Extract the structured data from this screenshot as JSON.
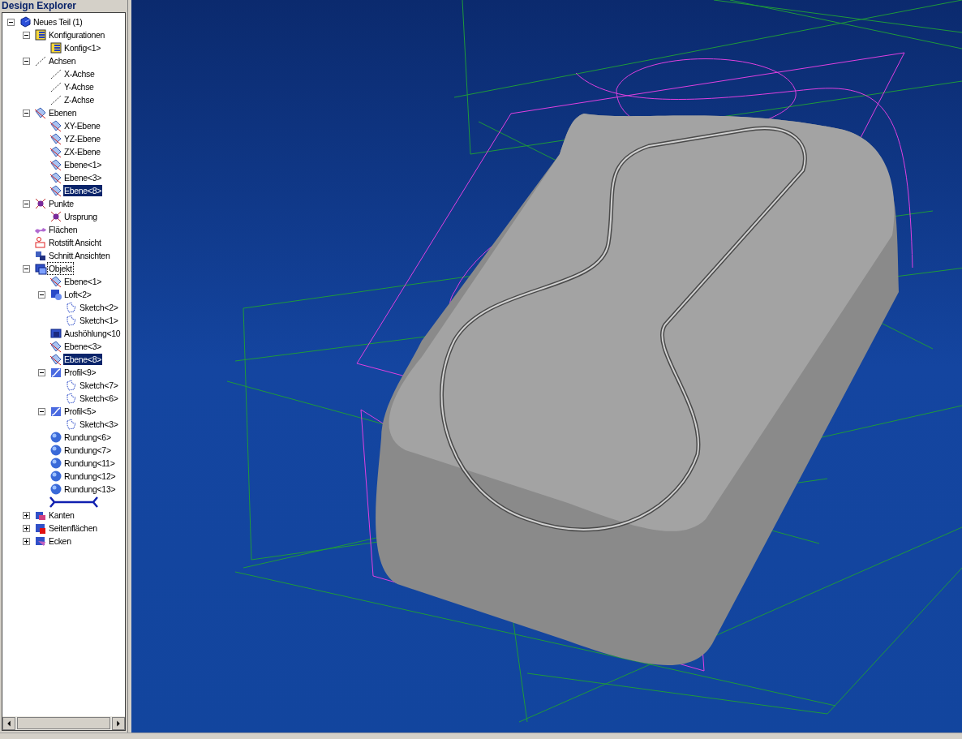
{
  "panel": {
    "title": "Design Explorer"
  },
  "tree": [
    {
      "label": "Neues Teil (1)",
      "kind": "part",
      "expanded": true,
      "selected": false,
      "focused": false,
      "children": [
        {
          "label": "Konfigurationen",
          "kind": "config",
          "expanded": true,
          "selected": false,
          "focused": false,
          "children": [
            {
              "label": "Konfig<1>",
              "kind": "config",
              "selected": false,
              "focused": false
            }
          ]
        },
        {
          "label": "Achsen",
          "kind": "axis",
          "expanded": true,
          "selected": false,
          "focused": false,
          "children": [
            {
              "label": "X-Achse",
              "kind": "axis",
              "selected": false,
              "focused": false
            },
            {
              "label": "Y-Achse",
              "kind": "axis",
              "selected": false,
              "focused": false
            },
            {
              "label": "Z-Achse",
              "kind": "axis",
              "selected": false,
              "focused": false
            }
          ]
        },
        {
          "label": "Ebenen",
          "kind": "plane",
          "expanded": true,
          "selected": false,
          "focused": false,
          "children": [
            {
              "label": "XY-Ebene",
              "kind": "plane",
              "selected": false,
              "focused": false
            },
            {
              "label": "YZ-Ebene",
              "kind": "plane",
              "selected": false,
              "focused": false
            },
            {
              "label": "ZX-Ebene",
              "kind": "plane",
              "selected": false,
              "focused": false
            },
            {
              "label": "Ebene<1>",
              "kind": "plane",
              "selected": false,
              "focused": false
            },
            {
              "label": "Ebene<3>",
              "kind": "plane",
              "selected": false,
              "focused": false
            },
            {
              "label": "Ebene<8>",
              "kind": "plane",
              "selected": true,
              "focused": false
            }
          ]
        },
        {
          "label": "Punkte",
          "kind": "point",
          "expanded": true,
          "selected": false,
          "focused": false,
          "children": [
            {
              "label": "Ursprung",
              "kind": "point",
              "selected": false,
              "focused": false
            }
          ]
        },
        {
          "label": "Flächen",
          "kind": "surface",
          "selected": false,
          "focused": false
        },
        {
          "label": "Rotstift Ansicht",
          "kind": "redline",
          "selected": false,
          "focused": false
        },
        {
          "label": "Schnitt Ansichten",
          "kind": "section",
          "selected": false,
          "focused": false
        },
        {
          "label": "Objekt",
          "kind": "body",
          "expanded": true,
          "selected": false,
          "focused": true,
          "children": [
            {
              "label": "Ebene<1>",
              "kind": "plane",
              "selected": false,
              "focused": false
            },
            {
              "label": "Loft<2>",
              "kind": "loft",
              "expanded": true,
              "selected": false,
              "focused": false,
              "children": [
                {
                  "label": "Sketch<2>",
                  "kind": "sketch",
                  "selected": false,
                  "focused": false
                },
                {
                  "label": "Sketch<1>",
                  "kind": "sketch",
                  "selected": false,
                  "focused": false
                }
              ]
            },
            {
              "label": "Aushöhlung<10",
              "kind": "shell",
              "selected": false,
              "focused": false
            },
            {
              "label": "Ebene<3>",
              "kind": "plane",
              "selected": false,
              "focused": false
            },
            {
              "label": "Ebene<8>",
              "kind": "plane",
              "selected": true,
              "focused": false
            },
            {
              "label": "Profil<9>",
              "kind": "profile",
              "expanded": true,
              "selected": false,
              "focused": false,
              "children": [
                {
                  "label": "Sketch<7>",
                  "kind": "sketch",
                  "selected": false,
                  "focused": false
                },
                {
                  "label": "Sketch<6>",
                  "kind": "sketch",
                  "selected": false,
                  "focused": false
                }
              ]
            },
            {
              "label": "Profil<5>",
              "kind": "profile",
              "expanded": true,
              "selected": false,
              "focused": false,
              "children": [
                {
                  "label": "Sketch<3>",
                  "kind": "sketch",
                  "selected": false,
                  "focused": false
                }
              ]
            },
            {
              "label": "Rundung<6>",
              "kind": "fillet",
              "selected": false,
              "focused": false
            },
            {
              "label": "Rundung<7>",
              "kind": "fillet",
              "selected": false,
              "focused": false
            },
            {
              "label": "Rundung<11>",
              "kind": "fillet",
              "selected": false,
              "focused": false
            },
            {
              "label": "Rundung<12>",
              "kind": "fillet",
              "selected": false,
              "focused": false
            },
            {
              "label": "Rundung<13>",
              "kind": "fillet",
              "selected": false,
              "focused": false
            },
            {
              "kind": "rollback"
            }
          ]
        },
        {
          "label": "Kanten",
          "kind": "edge",
          "expanded": false,
          "selected": false,
          "focused": false
        },
        {
          "label": "Seitenflächen",
          "kind": "face",
          "expanded": false,
          "selected": false,
          "focused": false
        },
        {
          "label": "Ecken",
          "kind": "vertex",
          "expanded": false,
          "selected": false,
          "focused": false
        }
      ]
    }
  ]
}
